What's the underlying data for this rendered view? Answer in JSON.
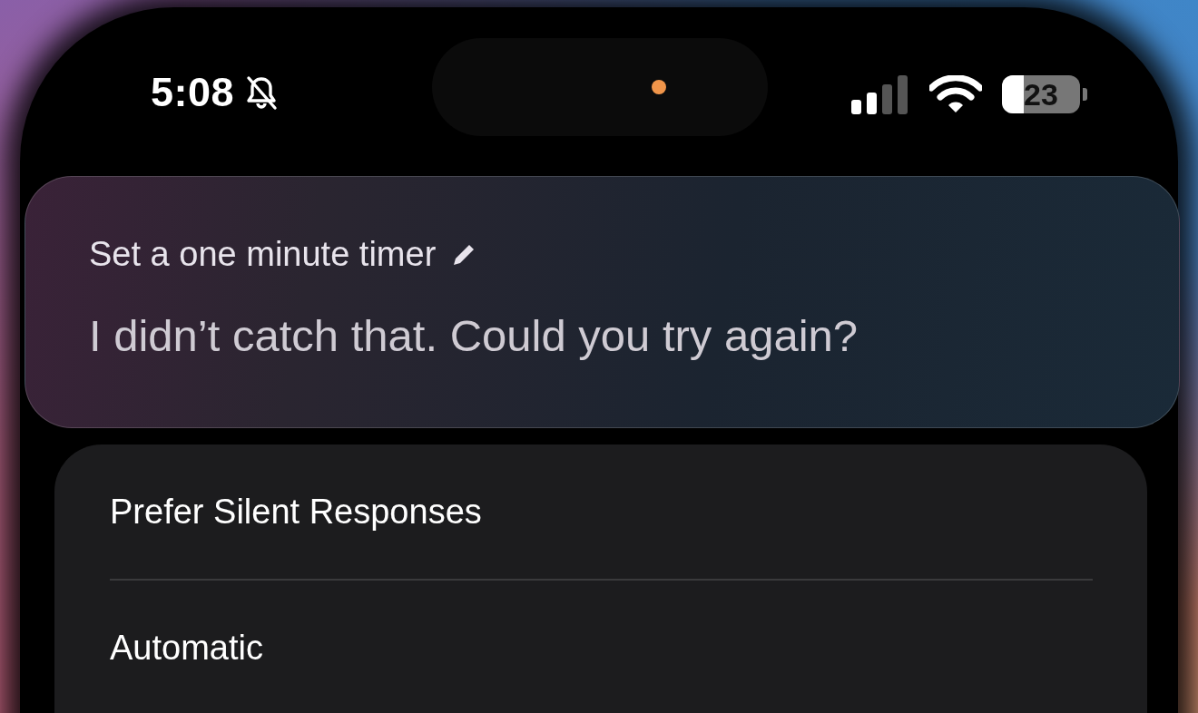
{
  "status_bar": {
    "time": "5:08",
    "silent": true,
    "battery": "23"
  },
  "siri": {
    "request": "Set a one minute timer",
    "response": "I didn’t catch that. Could you try again?"
  },
  "settings": {
    "rows": [
      {
        "label": "Prefer Silent Responses"
      },
      {
        "label": "Automatic"
      }
    ]
  }
}
